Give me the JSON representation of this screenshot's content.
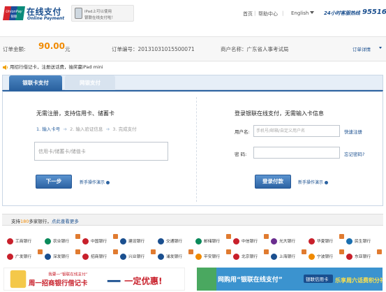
{
  "header": {
    "brand_logo_top": "UnionPay",
    "brand_logo_bottom": "银联",
    "brand_title": "在线支付",
    "brand_subtitle": "Online Payment",
    "ipad_line1": "iPad上可以使用",
    "ipad_line2": "银联在线支付啦！",
    "nav": {
      "home": "首页",
      "help": "帮助中心",
      "language": "English"
    },
    "hotline_label": "24小时客服热线",
    "hotline_number": "95516"
  },
  "order": {
    "amount_label": "订单金额:",
    "amount_value": "90.00",
    "amount_unit": "元",
    "number": "订单编号：20131031015500071",
    "merchant": "商户名称：广东省人事考试局",
    "detail_link": "订单详情"
  },
  "promo": {
    "text": "用招行借记卡，注册送话费，抽奖赢iPad mini"
  },
  "tabs": [
    {
      "label": "银联卡支付",
      "active": true
    },
    {
      "label": "网银支付",
      "active": false
    }
  ],
  "left_panel": {
    "title": "无需注册，支持信用卡、储蓄卡",
    "steps": [
      "1. 输入卡号",
      "2. 输入验证信息",
      "3. 完成支付"
    ],
    "card_placeholder": "信用卡/储蓄卡/储值卡",
    "next_button": "下一步",
    "demo_link": "新手操作演示"
  },
  "right_panel": {
    "title": "登录银联在线支付，无需输入卡信息",
    "username_label": "用户名:",
    "username_placeholder": "手机号/邮箱/自定义用户名",
    "register_link": "快速注册",
    "password_label": "密    码:",
    "forgot_link": "忘记密码?",
    "login_button": "登录付款",
    "demo_link": "新手操作演示"
  },
  "banks": {
    "header_prefix": "支持",
    "header_count": "180",
    "header_suffix": "多家银行，",
    "header_more": "点此查看更多",
    "row1": [
      "工商银行",
      "农业银行",
      "中国银行",
      "建设银行",
      "交通银行",
      "邮储银行",
      "中信银行",
      "光大银行",
      "华夏银行",
      "民生银行"
    ],
    "row2": [
      "广发银行",
      "深发银行",
      "招商银行",
      "兴业银行",
      "浦发银行",
      "平安银行",
      "北京银行",
      "上海银行",
      "宁波银行",
      "东亚银行"
    ],
    "colors": [
      "#c8202b",
      "#0a8a5a",
      "#c8202b",
      "#1a4f8f",
      "#1a4f8f",
      "#0a8a5a",
      "#c8202b",
      "#6a2d8f",
      "#c8202b",
      "#1a6fb0"
    ],
    "colors2": [
      "#c8202b",
      "#1a4f8f",
      "#c8202b",
      "#1a4f8f",
      "#1a4f8f",
      "#f08a00",
      "#c8202b",
      "#1a4f8f",
      "#f08a00",
      "#c8202b"
    ]
  },
  "banners": {
    "left_small": "我要一“银联在线支付”",
    "left_main": "周一招商银行借记卡",
    "left_offer": "一定优惠!",
    "right_main": "网购用“银联在线支付”",
    "right_sub": "银联信用卡",
    "right_offer": "乐享周六话费积分礼"
  }
}
